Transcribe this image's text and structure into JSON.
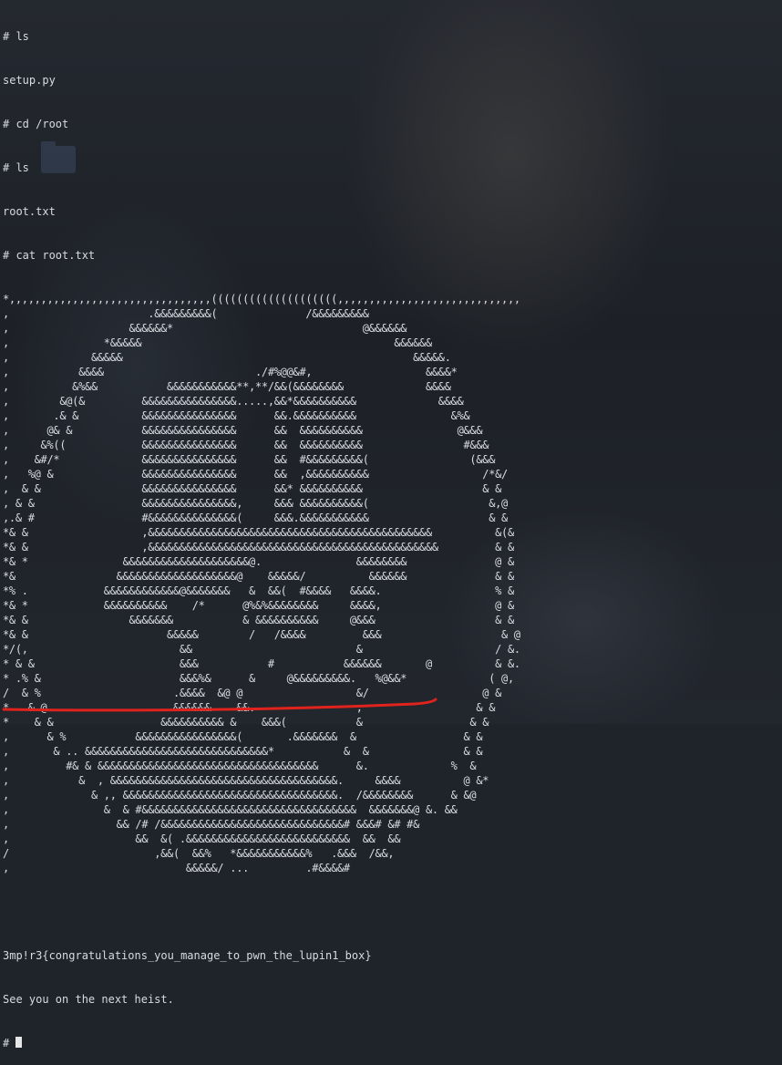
{
  "terminal": {
    "commands": [
      "# ls",
      "setup.py",
      "# cd /root",
      "# ls",
      "root.txt",
      "# cat root.txt"
    ],
    "art": [
      "*,,,,,,,,,,,,,,,,,,,,,,,,,,,,,,,,((((((((((((((((((((,,,,,,,,,,,,,,,,,,,,,,,,,,,,,",
      ",                      .&&&&&&&&&(              /&&&&&&&&&",
      ",                   &&&&&&*                              @&&&&&&",
      ",               *&&&&&                                        &&&&&&",
      ",             &&&&&                                              &&&&&.",
      ",           &&&&                        ./#%@@&#,                  &&&&*",
      ",          &%&&           &&&&&&&&&&&**,**/&&(&&&&&&&&             &&&&",
      ",        &@(&         &&&&&&&&&&&&&&&.....,&&*&&&&&&&&&&             &&&&",
      ",       .& &          &&&&&&&&&&&&&&&      &&.&&&&&&&&&&               &%&",
      ",      @& &           &&&&&&&&&&&&&&&      &&  &&&&&&&&&&               @&&&",
      ",     &%((            &&&&&&&&&&&&&&&      &&  &&&&&&&&&&                #&&&",
      ",    &#/*             &&&&&&&&&&&&&&&      &&  #&&&&&&&&&(                (&&&",
      ",   %@ &              &&&&&&&&&&&&&&&      &&  ,&&&&&&&&&&                  /*&/",
      ",  & &                &&&&&&&&&&&&&&&      &&* &&&&&&&&&&                   & &",
      ", & &                 &&&&&&&&&&&&&&&,     &&& &&&&&&&&&&(                   &,@",
      ",.& #                 #&&&&&&&&&&&&&&(     &&&.&&&&&&&&&&&                   & &",
      "*& &                  ,&&&&&&&&&&&&&&&&&&&&&&&&&&&&&&&&&&&&&&&&&&&&&          &(&",
      "*& &                  ,&&&&&&&&&&&&&&&&&&&&&&&&&&&&&&&&&&&&&&&&&&&&&&         & &",
      "*& *               &&&&&&&&&&&&&&&&&&&&@.               &&&&&&&&              @ &",
      "*&                &&&&&&&&&&&&&&&&&&&@    &&&&&/          &&&&&&              & &",
      "*% .            &&&&&&&&&&&&@&&&&&&&   &  &&(  #&&&&   &&&&.                  % &",
      "*& *            &&&&&&&&&&    /*      @%&%&&&&&&&&     &&&&,                  @ &",
      "*& &                &&&&&&&           & &&&&&&&&&&     @&&&                   & &",
      "*& &                      &&&&&        /   /&&&&         &&&                   & @",
      "*/(,                        &&                          &                     / &.",
      "* & &                       &&&           #           &&&&&&       @          & &.",
      "* .% &                      &&&%&      &     @&&&&&&&&&.   %@&&*             ( @,",
      "/  & %                     .&&&&  &@ @                  &/                  @ &",
      "*   & @                    &&&&&&    &&.                ,                  & &",
      "*    & &                 &&&&&&&&&& &    &&&(           &                 & &",
      ",      & %           &&&&&&&&&&&&&&&&(       .&&&&&&&  &                 & &",
      ",       & .. &&&&&&&&&&&&&&&&&&&&&&&&&&&&&*           &  &               & &",
      ",         #& & &&&&&&&&&&&&&&&&&&&&&&&&&&&&&&&&&&&      &.             %  &",
      ",           &  , &&&&&&&&&&&&&&&&&&&&&&&&&&&&&&&&&&&&.     &&&&          @ &*",
      ",             & ,, &&&&&&&&&&&&&&&&&&&&&&&&&&&&&&&&&&.  /&&&&&&&&      & &@",
      ",               &  & #&&&&&&&&&&&&&&&&&&&&&&&&&&&&&&&&&&  &&&&&&&@ &. &&",
      ",                 && /# /&&&&&&&&&&&&&&&&&&&&&&&&&&&&&# &&&# &# #&",
      ",                    &&  &( .&&&&&&&&&&&&&&&&&&&&&&&&&&  &&  &&",
      "/                       ,&&(  &&%   *&&&&&&&&&&&%   .&&&  /&&,",
      ",                            &&&&&/ ...         .#&&&&#"
    ],
    "flag": "3mp!r3{congratulations_you_manage_to_pwn_the_lupin1_box}",
    "message": "See you on the next heist.",
    "prompt": "# "
  },
  "annotation": {
    "underline_color": "#e0231c"
  }
}
